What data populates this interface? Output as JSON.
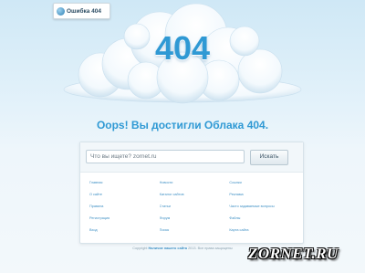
{
  "header": {
    "logo_text": "Ошибка 404",
    "logo_icon": "cloud-logo-icon"
  },
  "hero": {
    "code": "404"
  },
  "headline": "Oops! Вы достигли Облака 404.",
  "search": {
    "value": "Что вы ищете? zornet.ru",
    "button_label": "Искать"
  },
  "links": {
    "col1": [
      "Главная",
      "О сайте",
      "Правила",
      "Регистрация",
      "Вход"
    ],
    "col2": [
      "Новости",
      "Каталог сайтов",
      "Статьи",
      "Форум",
      "Поиск"
    ],
    "col3": [
      "Ссылки",
      "Реклама",
      "Часто задаваемые вопросы",
      "Файлы",
      "Карта сайта"
    ]
  },
  "footer": {
    "text": "Copyright",
    "link": "Наличие нашего сайта",
    "tail": "2013. Все права защищены"
  },
  "watermark": "ZORNET.RU",
  "colors": {
    "accent": "#2f99d4",
    "sky": "#cfe8f6",
    "link": "#3d8fc4"
  }
}
